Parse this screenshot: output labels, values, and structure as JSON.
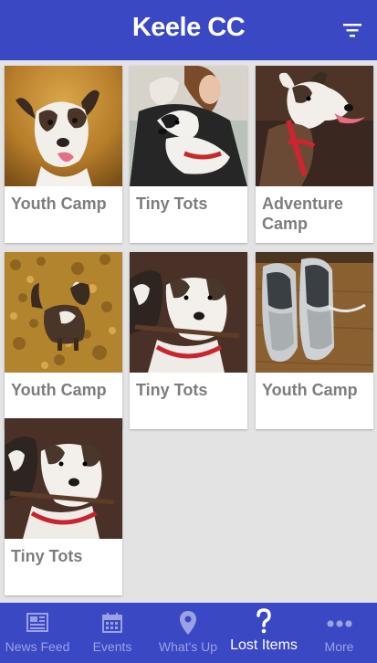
{
  "header": {
    "title": "Keele CC",
    "filter_icon": "filter-icon"
  },
  "cards": [
    {
      "label": "Youth Camp",
      "photo": "dog-portrait-autumn"
    },
    {
      "label": "Tiny Tots",
      "photo": "woman-with-dog"
    },
    {
      "label": "Adventure Camp",
      "photo": "dog-red-harness"
    },
    {
      "label": "Youth Camp",
      "photo": "dog-in-leaves"
    },
    {
      "label": "Tiny Tots",
      "photo": "two-dogs-stick"
    },
    {
      "label": "Youth Camp",
      "photo": "sneakers-on-floor"
    },
    {
      "label": "Tiny Tots",
      "photo": "two-dogs-stick"
    }
  ],
  "tabs": [
    {
      "label": "News Feed",
      "icon": "newspaper-icon",
      "active": false
    },
    {
      "label": "Events",
      "icon": "calendar-icon",
      "active": false
    },
    {
      "label": "What's Up",
      "icon": "map-pin-icon",
      "active": false
    },
    {
      "label": "Lost Items",
      "icon": "question-icon",
      "active": true
    },
    {
      "label": "More",
      "icon": "more-dots-icon",
      "active": false
    }
  ],
  "colors": {
    "primary": "#3b48c4",
    "background": "#e3e3e3",
    "card_label": "#7d7d7d",
    "tab_inactive": "#9aa2e2",
    "tab_active": "#ffffff"
  }
}
